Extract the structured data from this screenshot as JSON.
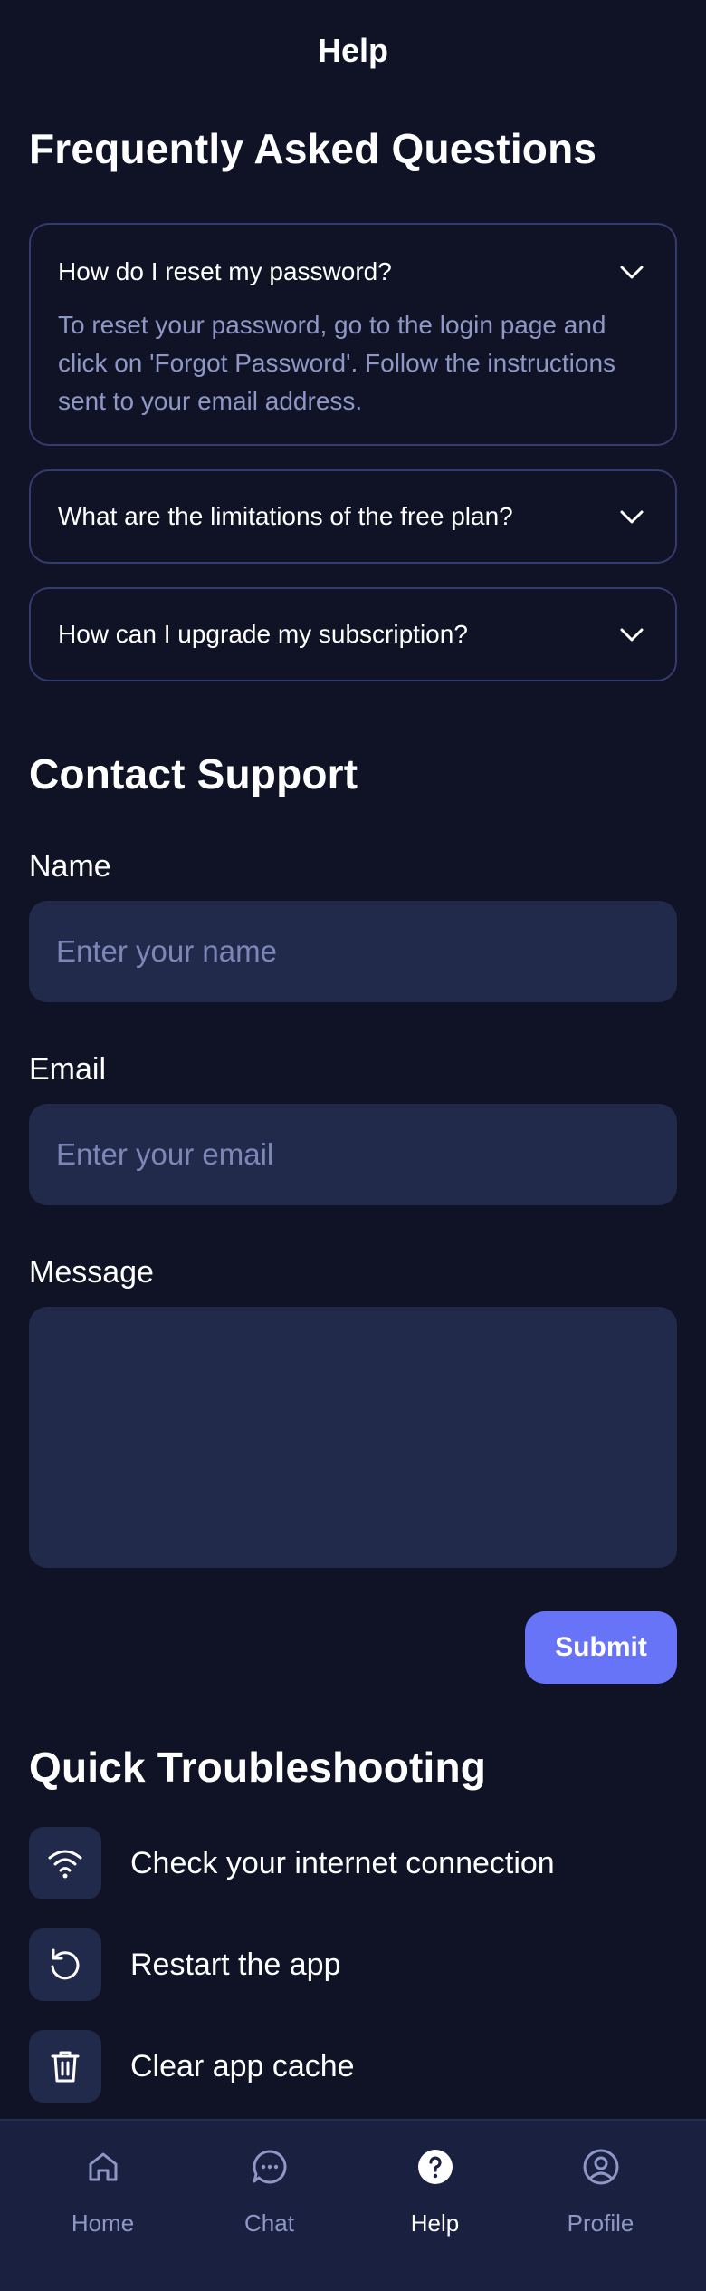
{
  "header": {
    "title": "Help"
  },
  "faq": {
    "title": "Frequently Asked Questions",
    "items": [
      {
        "question": "How do I reset my password?",
        "answer": "To reset your password, go to the login page and click on 'Forgot Password'. Follow the instructions sent to your email address.",
        "expanded": true
      },
      {
        "question": "What are the limitations of the free plan?",
        "expanded": false
      },
      {
        "question": "How can I upgrade my subscription?",
        "expanded": false
      }
    ]
  },
  "contact": {
    "title": "Contact Support",
    "name_label": "Name",
    "name_placeholder": "Enter your name",
    "name_value": "",
    "email_label": "Email",
    "email_placeholder": "Enter your email",
    "email_value": "",
    "message_label": "Message",
    "message_value": "",
    "submit_label": "Submit"
  },
  "troubleshooting": {
    "title": "Quick Troubleshooting",
    "items": [
      {
        "label": "Check your internet connection",
        "icon": "wifi-icon"
      },
      {
        "label": "Restart the app",
        "icon": "restart-icon"
      },
      {
        "label": "Clear app cache",
        "icon": "trash-icon"
      }
    ]
  },
  "nav": {
    "items": [
      {
        "label": "Home",
        "icon": "home-icon",
        "active": false
      },
      {
        "label": "Chat",
        "icon": "chat-icon",
        "active": false
      },
      {
        "label": "Help",
        "icon": "help-icon",
        "active": true
      },
      {
        "label": "Profile",
        "icon": "profile-icon",
        "active": false
      }
    ]
  },
  "colors": {
    "background": "#0f1325",
    "surface": "#212a4b",
    "nav_background": "#1a2040",
    "accent": "#6874f7",
    "muted_text": "#8f97c6",
    "card_border": "#343b6e"
  }
}
